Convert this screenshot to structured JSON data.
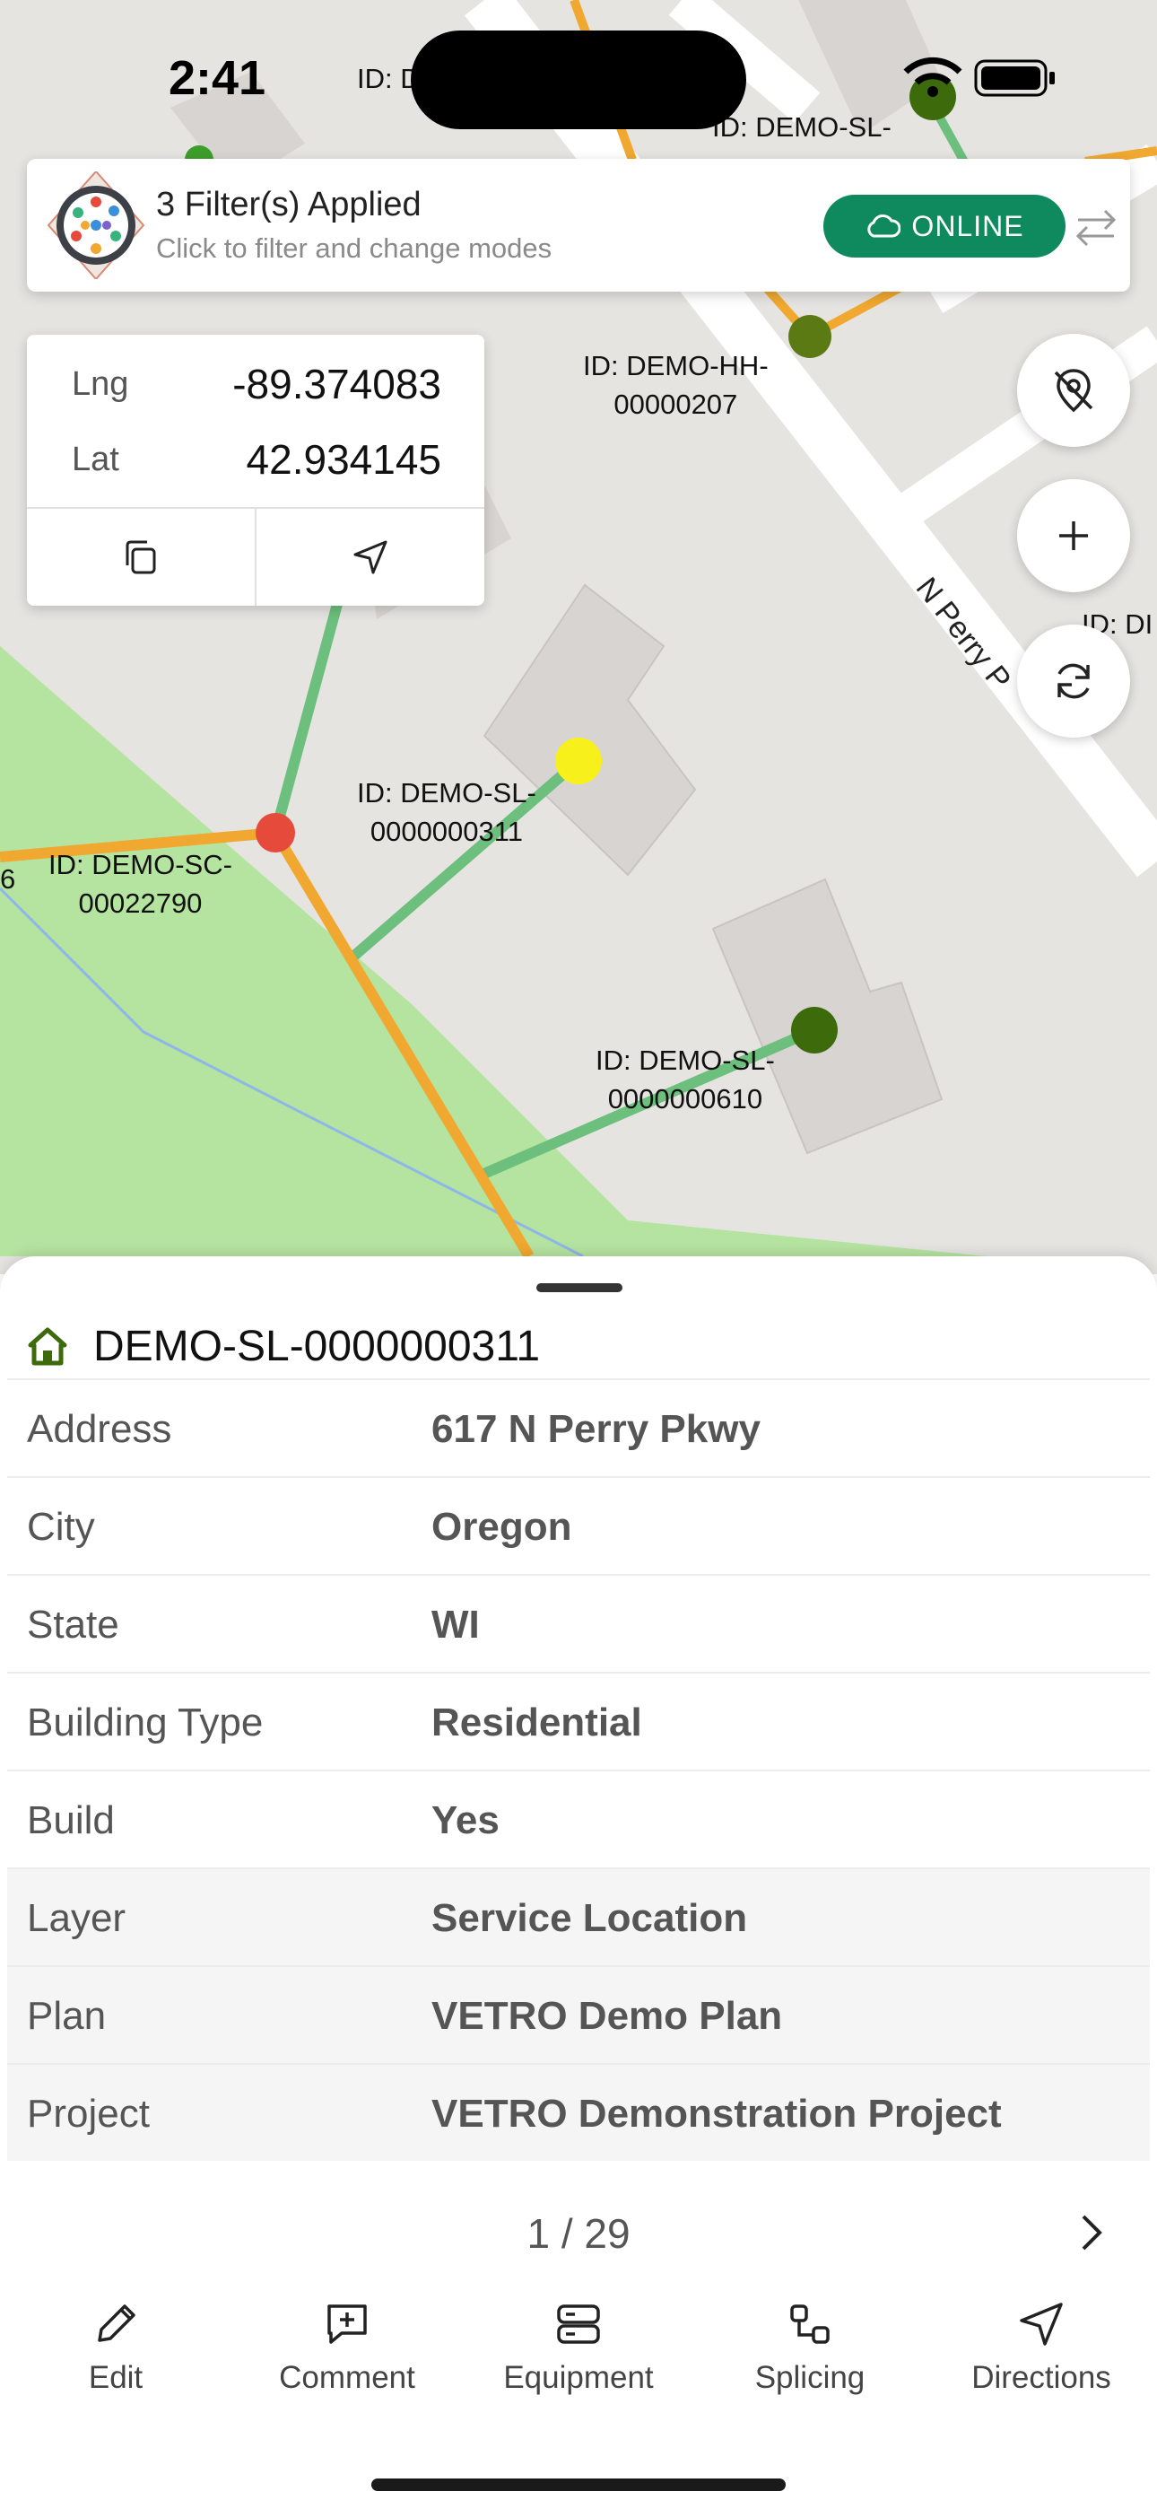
{
  "status_bar": {
    "time": "2:41"
  },
  "map": {
    "labels": {
      "sl_311": "ID: DEMO-SL-\n0000000311",
      "sc_22790": "ID: DEMO-SC-\n00022790",
      "sl_610": "ID: DEMO-SL-\n0000000610",
      "hh_207": "ID: DEMO-HH-\n00000207",
      "sl_top": "ID: DEMO-SL-",
      "top_left_id": "ID: D",
      "right_edge_id": "ID: DI",
      "left_edge_num": "6",
      "street_name": "N Perry P"
    }
  },
  "filter_banner": {
    "title": "3 Filter(s) Applied",
    "subtitle": "Click to filter and change modes",
    "status": "ONLINE"
  },
  "coordinates": {
    "lng_label": "Lng",
    "lng_value": "-89.374083",
    "lat_label": "Lat",
    "lat_value": "42.934145"
  },
  "sheet": {
    "title": "DEMO-SL-0000000311",
    "rows": [
      {
        "key": "Address",
        "value": "617 N Perry Pkwy"
      },
      {
        "key": "City",
        "value": "Oregon"
      },
      {
        "key": "State",
        "value": "WI"
      },
      {
        "key": "Building Type",
        "value": "Residential"
      },
      {
        "key": "Build",
        "value": "Yes"
      },
      {
        "key": "Layer",
        "value": "Service Location"
      },
      {
        "key": "Plan",
        "value": "VETRO Demo Plan"
      },
      {
        "key": "Project",
        "value": "VETRO Demonstration Project"
      }
    ],
    "pager": "1 / 29"
  },
  "nav": {
    "edit": "Edit",
    "comment": "Comment",
    "equipment": "Equipment",
    "splicing": "Splicing",
    "directions": "Directions"
  },
  "colors": {
    "accent_green": "#0f8a5f",
    "fiber_orange": "#f0a830",
    "drop_green": "#6cbf7c",
    "park_green": "#b5e3a0",
    "node_dark_green": "#3d6b0c",
    "node_red": "#e64a3b",
    "node_yellow": "#f7f01a"
  }
}
